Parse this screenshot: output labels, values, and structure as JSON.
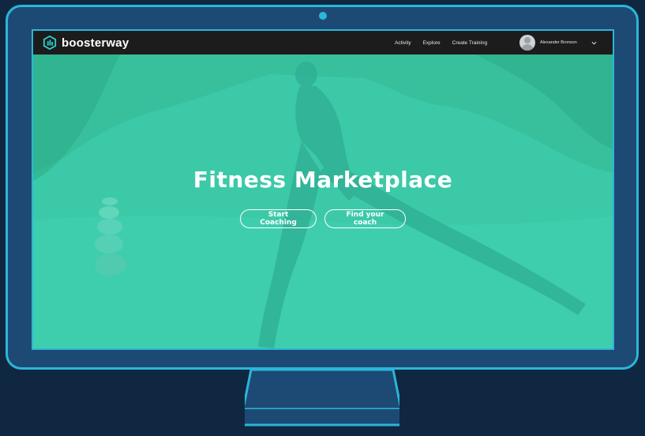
{
  "app": {
    "brand": "boosterway",
    "brand_logo_icon": "boosterway-logo-icon"
  },
  "nav": {
    "links": [
      "Activity",
      "Explore",
      "Create Training"
    ],
    "user_name": "Alexander Bronson",
    "dropdown_icon": "chevron-down-icon"
  },
  "hero": {
    "title": "Fitness Marketplace",
    "buttons": {
      "start": "Start Coaching",
      "find": "Find your coach"
    },
    "overlay_color": "#3fd0b0"
  },
  "colors": {
    "frame_accent": "#2bb6d8",
    "frame_body": "#1d4a74",
    "background": "#0f2741",
    "navbar": "#1c1c1c"
  }
}
